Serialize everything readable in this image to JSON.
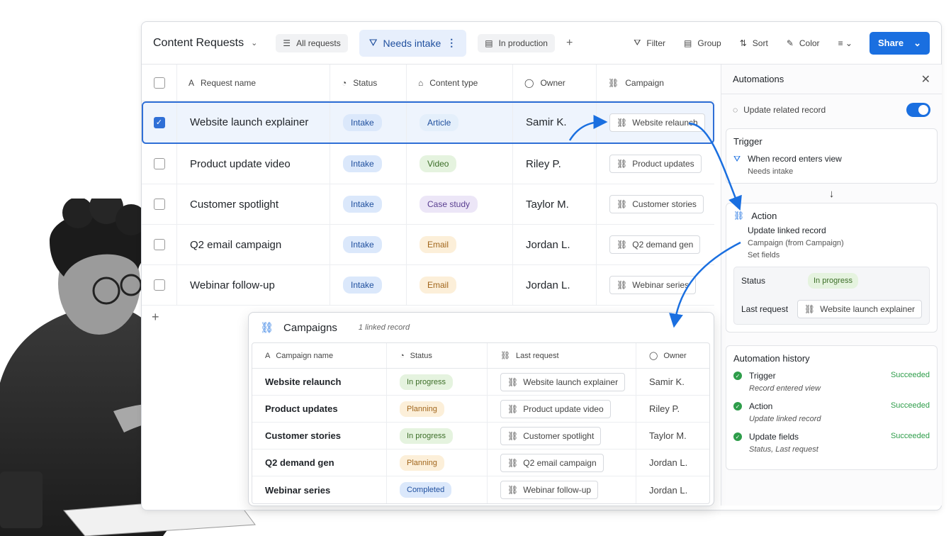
{
  "toolbar": {
    "base_title": "Content Requests",
    "views": [
      "All requests",
      "Needs intake",
      "In production"
    ],
    "tools": [
      "Filter",
      "Group",
      "Sort",
      "Color"
    ],
    "share": "Share"
  },
  "table": {
    "headers": [
      "Request name",
      "Status",
      "Content type",
      "Owner",
      "Campaign"
    ],
    "rows": [
      {
        "name": "Website launch explainer",
        "status": "Intake",
        "type": "Article",
        "owner": "Samir K.",
        "campaign": "Website relaunch"
      },
      {
        "name": "Product update video",
        "status": "Intake",
        "type": "Video",
        "owner": "Riley P.",
        "campaign": "Product updates"
      },
      {
        "name": "Customer spotlight",
        "status": "Intake",
        "type": "Case study",
        "owner": "Taylor M.",
        "campaign": "Customer stories"
      },
      {
        "name": "Q2 email campaign",
        "status": "Intake",
        "type": "Email",
        "owner": "Jordan L.",
        "campaign": "Q2 demand gen"
      },
      {
        "name": "Webinar follow-up",
        "status": "Intake",
        "type": "Email",
        "owner": "Jordan L.",
        "campaign": "Webinar series"
      }
    ]
  },
  "automations": {
    "title": "Automations",
    "rule": "Update related record",
    "trigger": {
      "title": "Trigger",
      "line": "When record enters view",
      "sub": "Needs intake"
    },
    "action": {
      "title": "Action",
      "line": "Update linked record",
      "sub1": "Campaign (from Campaign)",
      "sub2": "Set fields",
      "status_label": "Status",
      "status_value": "In progress",
      "last_label": "Last request",
      "last_value": "Website launch explainer"
    },
    "history": {
      "title": "Automation history",
      "items": [
        {
          "name": "Trigger",
          "sub": "Record entered view",
          "state": "Succeeded"
        },
        {
          "name": "Action",
          "sub": "Update linked record",
          "state": "Succeeded"
        },
        {
          "name": "Update fields",
          "sub": "Status, Last request",
          "state": "Succeeded"
        }
      ]
    }
  },
  "campaigns": {
    "title": "Campaigns",
    "count": "1 linked record",
    "headers": [
      "Campaign name",
      "Status",
      "Last request",
      "Owner"
    ],
    "rows": [
      {
        "name": "Website relaunch",
        "status": "In progress",
        "last": "Website launch explainer",
        "owner": "Samir K."
      },
      {
        "name": "Product updates",
        "status": "Planning",
        "last": "Product update video",
        "owner": "Riley P."
      },
      {
        "name": "Customer stories",
        "status": "In progress",
        "last": "Customer spotlight",
        "owner": "Taylor M."
      },
      {
        "name": "Q2 demand gen",
        "status": "Planning",
        "last": "Q2 email campaign",
        "owner": "Jordan L."
      },
      {
        "name": "Webinar series",
        "status": "Completed",
        "last": "Webinar follow-up",
        "owner": "Jordan L."
      }
    ]
  },
  "colors": {
    "accent": "#1a6fe0",
    "success": "#2e9d4a"
  }
}
